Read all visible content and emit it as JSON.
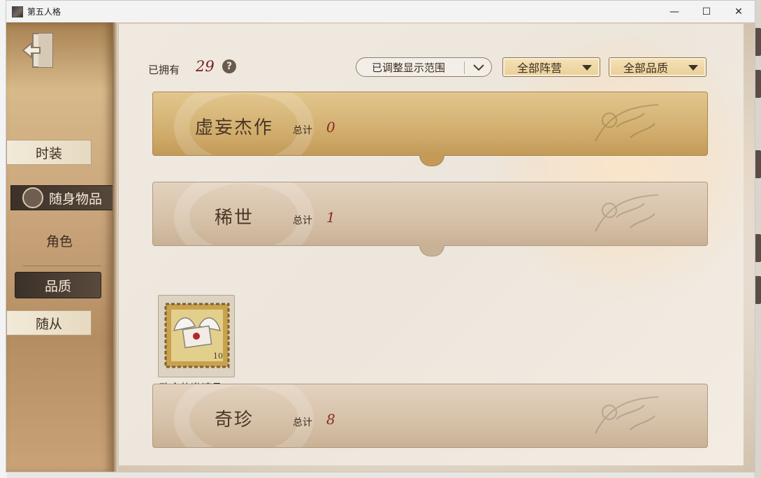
{
  "window": {
    "title": "第五人格",
    "controls": {
      "minimize": "—",
      "maximize": "☐",
      "close": "✕"
    }
  },
  "sidebar": {
    "exit_icon": "exit-door-icon",
    "items": [
      {
        "label": "时装",
        "state": "normal"
      },
      {
        "label": "随身物品",
        "state": "active",
        "icon": "shield-emblem-icon"
      },
      {
        "label": "角色",
        "state": "plain"
      },
      {
        "label": "品质",
        "state": "selected"
      },
      {
        "label": "随从",
        "state": "normal"
      }
    ]
  },
  "header": {
    "owned_label": "已拥有",
    "owned_count": "29",
    "help_icon": "?"
  },
  "filters": {
    "display_range": "已调整显示范围",
    "camp": "全部阵营",
    "quality": "全部品质"
  },
  "groups": [
    {
      "title": "虚妄杰作",
      "total_label": "总计",
      "count": "0",
      "style": "gold"
    },
    {
      "title": "稀世",
      "total_label": "总计",
      "count": "1",
      "style": "taupe"
    },
    {
      "title": "奇珍",
      "total_label": "总计",
      "count": "8",
      "style": "taupe"
    }
  ],
  "items": [
    {
      "name": "致命的邀请函",
      "icon": "winged-envelope-stamp-icon"
    }
  ],
  "colors": {
    "accent_red": "#8a2a22",
    "gold_banner": "#d2af6f",
    "dark_tab": "#3b3129"
  }
}
